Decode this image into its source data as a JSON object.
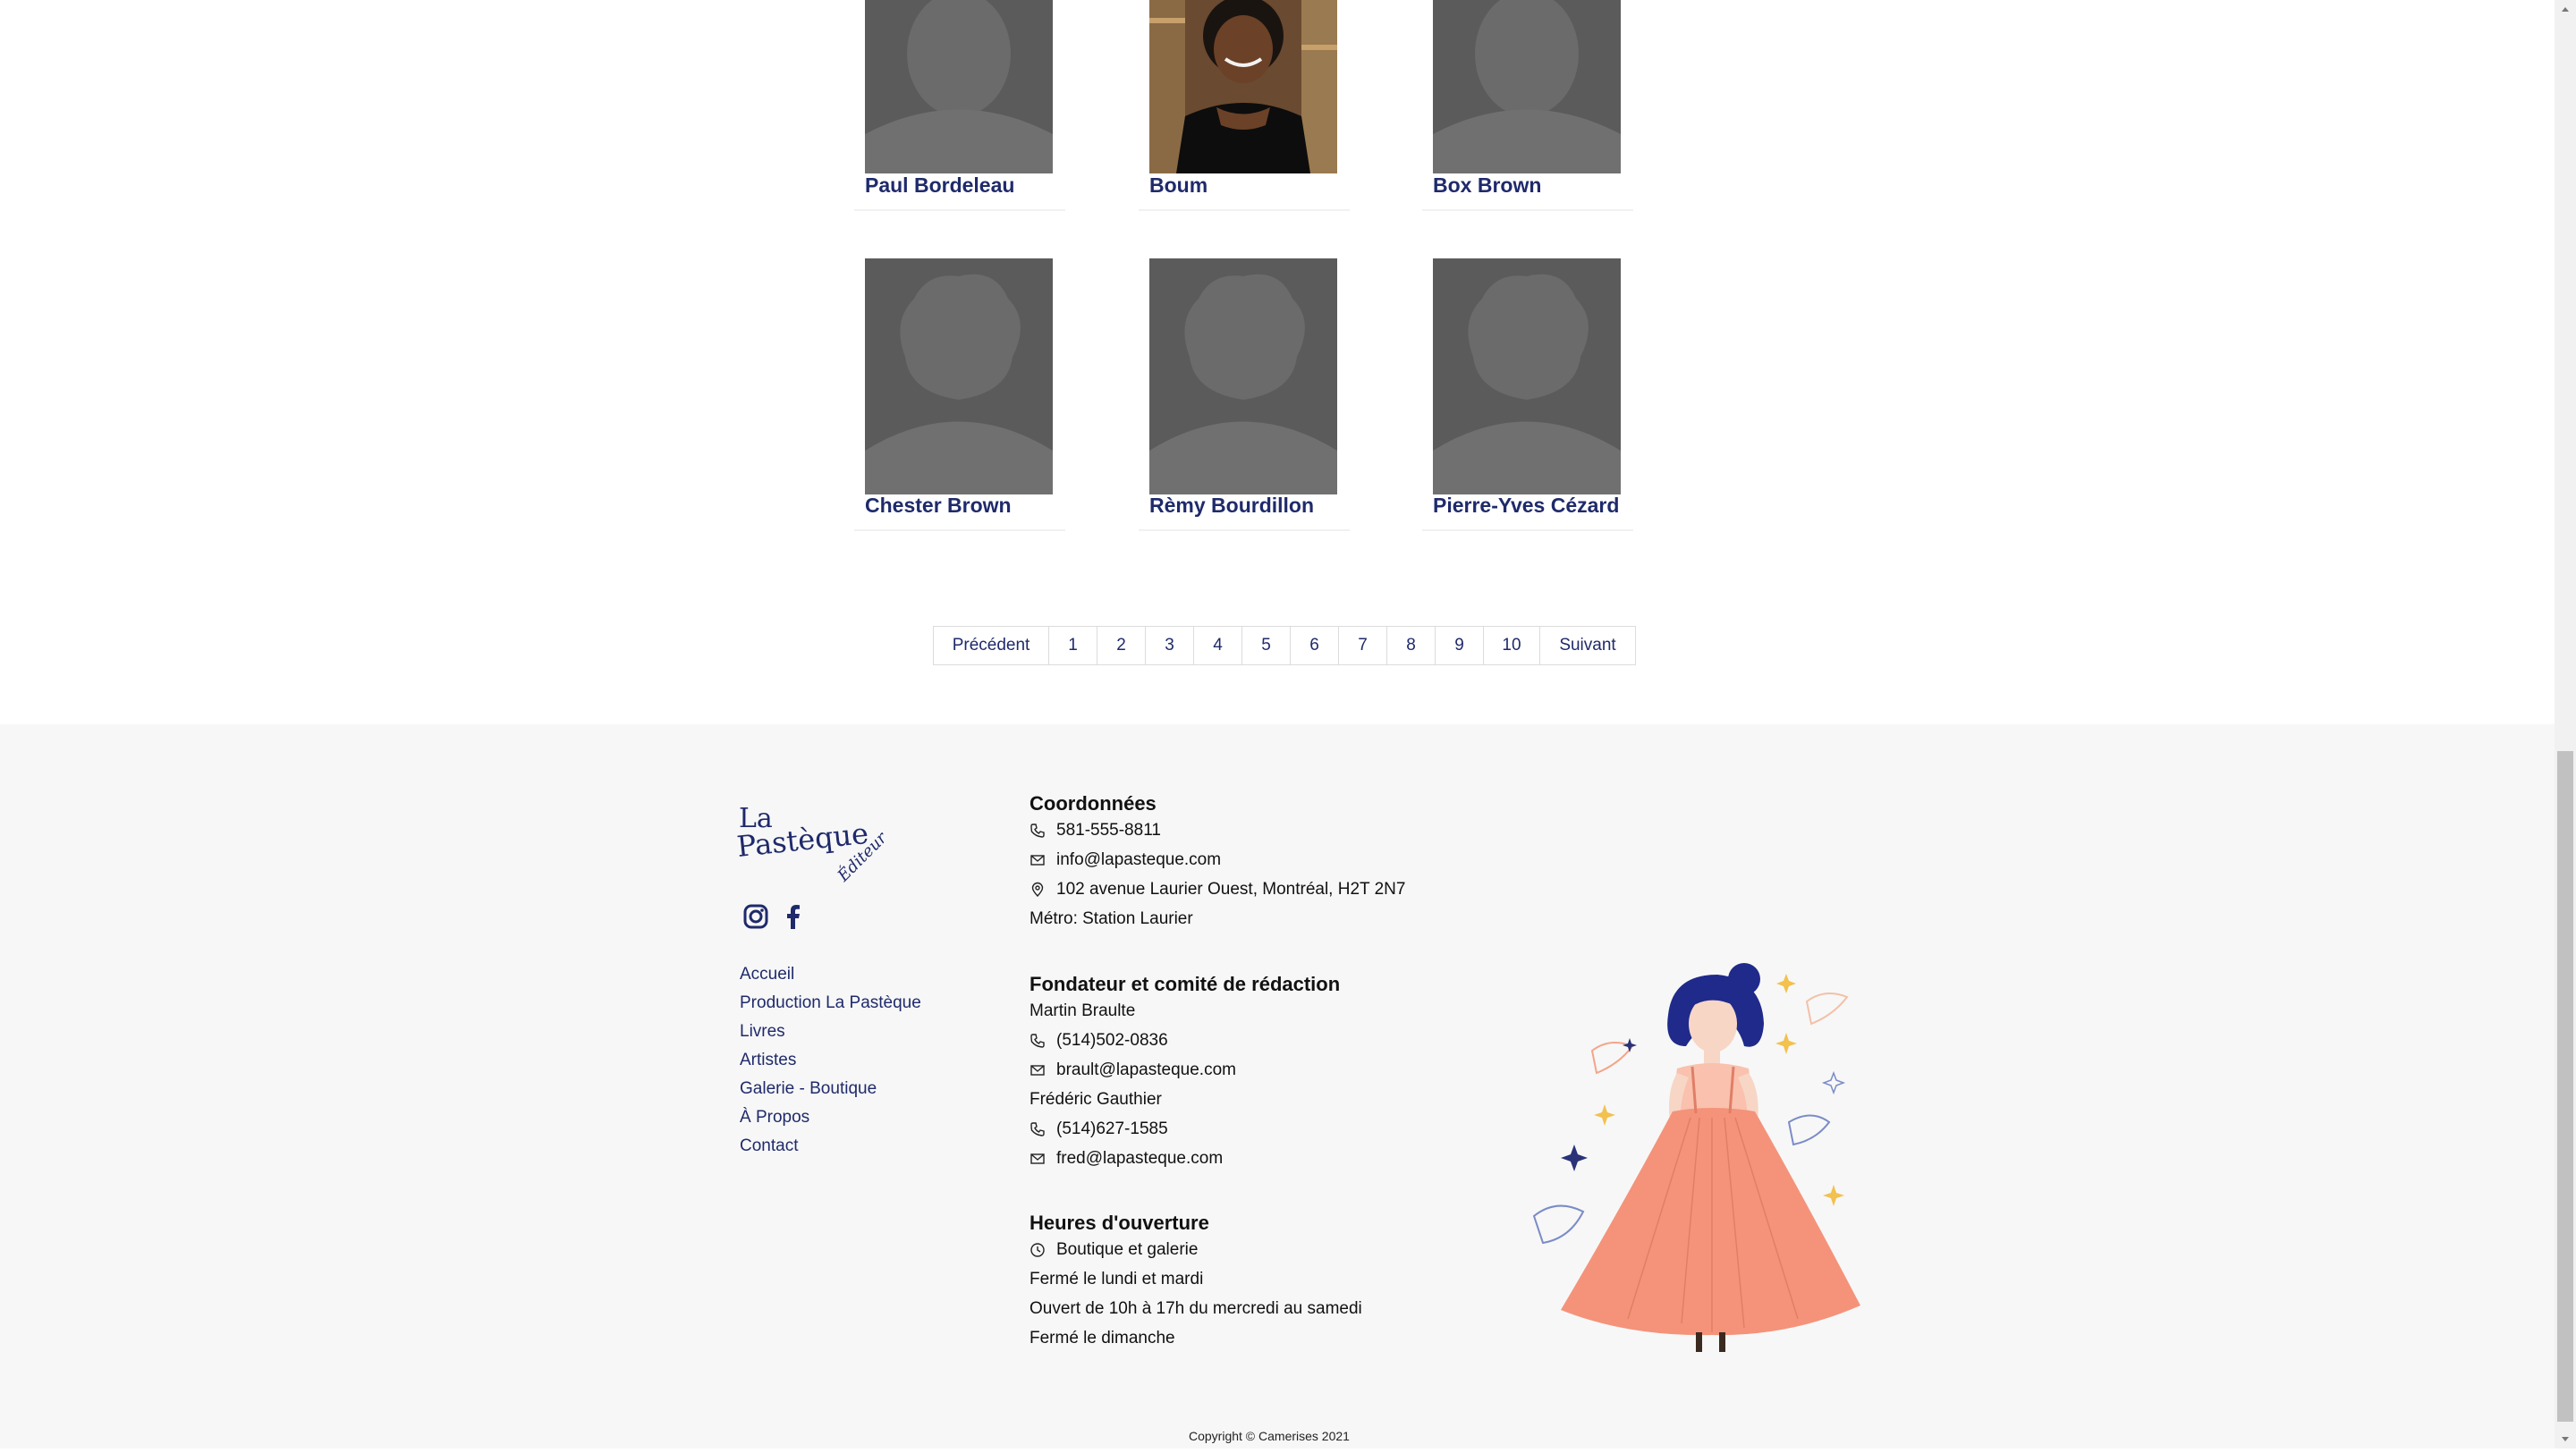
{
  "artists": [
    {
      "name": "Paul Bordeleau",
      "has_photo": false
    },
    {
      "name": "Boum",
      "has_photo": true
    },
    {
      "name": "Box Brown",
      "has_photo": false
    },
    {
      "name": "Chester Brown",
      "has_photo": false
    },
    {
      "name": "Rèmy Bourdillon",
      "has_photo": false
    },
    {
      "name": "Pierre-Yves Cézard",
      "has_photo": false
    }
  ],
  "pagination": {
    "prev": "Précédent",
    "pages": [
      "1",
      "2",
      "3",
      "4",
      "5",
      "6",
      "7",
      "8",
      "9",
      "10"
    ],
    "next": "Suivant"
  },
  "footer": {
    "logo": {
      "line1": "La",
      "line2": "Pastèque",
      "line3": "Éditeur"
    },
    "social": [
      "instagram-icon",
      "facebook-icon"
    ],
    "nav": [
      "Accueil",
      "Production La Pastèque",
      "Livres",
      "Artistes",
      "Galerie - Boutique",
      "À Propos",
      "Contact"
    ],
    "contact": {
      "title": "Coordonnées",
      "phone": "581-555-8811",
      "email": "info@lapasteque.com",
      "address": "102 avenue Laurier Ouest, Montréal, H2T 2N7",
      "metro": "Métro: Station Laurier"
    },
    "committee": {
      "title": "Fondateur et comité de rédaction",
      "p1_name": "Martin Braulte",
      "p1_phone": "(514)502-0836",
      "p1_email": "brault@lapasteque.com",
      "p2_name": "Frédéric Gauthier",
      "p2_phone": "(514)627-1585",
      "p2_email": "fred@lapasteque.com"
    },
    "hours": {
      "title": "Heures d'ouverture",
      "label": "Boutique et galerie",
      "l1": "Fermé le lundi et mardi",
      "l2": "Ouvert de 10h à 17h du mercredi au samedi",
      "l3": "Fermé le dimanche"
    },
    "copyright": "Copyright © Camerises 2021"
  },
  "colors": {
    "link": "#1f2a6b",
    "footer_bg": "#f7f7f7",
    "avatar_bg": "#5b5b5b",
    "dress": "#f4937a"
  }
}
